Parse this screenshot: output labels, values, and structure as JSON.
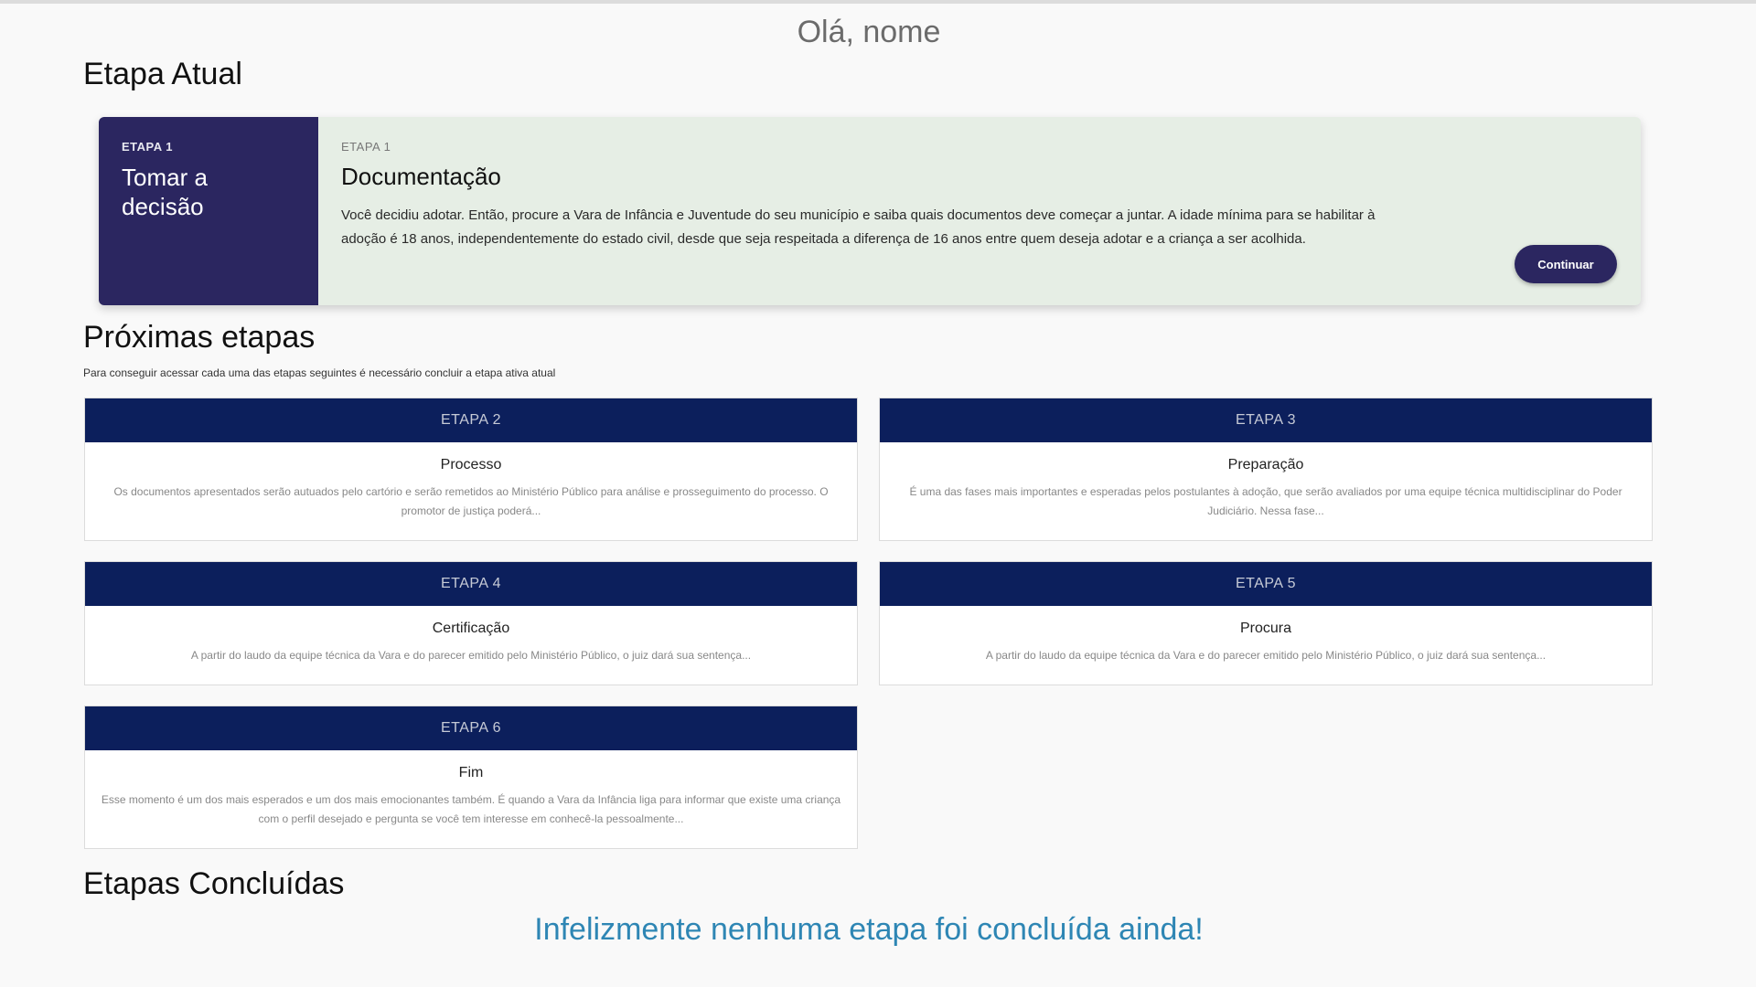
{
  "greeting": "Olá, nome",
  "sections": {
    "current_title": "Etapa Atual",
    "next_title": "Próximas etapas",
    "next_hint": "Para conseguir acessar cada uma das etapas seguintes é necessário concluir a etapa ativa atual",
    "done_title": "Etapas Concluídas",
    "done_empty": "Infelizmente nenhuma etapa foi concluída ainda!"
  },
  "current": {
    "left_eyebrow": "ETAPA 1",
    "left_name": "Tomar a decisão",
    "eyebrow": "ETAPA 1",
    "title": "Documentação",
    "description": "Você decidiu adotar. Então, procure a Vara de Infância e Juventude do seu município e saiba quais documentos deve começar a juntar. A idade mínima para se habilitar à adoção é 18 anos, independentemente do estado civil, desde que seja respeitada a diferença de 16 anos entre quem deseja adotar e a criança a ser acolhida.",
    "button": "Continuar"
  },
  "next_stages": [
    {
      "label": "ETAPA 2",
      "title": "Processo",
      "description": "Os documentos apresentados serão autuados pelo cartório e serão remetidos ao Ministério Público para análise e prosseguimento do processo. O promotor de justiça poderá..."
    },
    {
      "label": "ETAPA 3",
      "title": "Preparação",
      "description": "É uma das fases mais importantes e esperadas pelos postulantes à adoção, que serão avaliados por uma equipe técnica multidisciplinar do Poder Judiciário. Nessa fase..."
    },
    {
      "label": "ETAPA 4",
      "title": "Certificação",
      "description": "A partir do laudo da equipe técnica da Vara e do parecer emitido pelo Ministério Público, o juiz dará sua sentença..."
    },
    {
      "label": "ETAPA 5",
      "title": "Procura",
      "description": "A partir do laudo da equipe técnica da Vara e do parecer emitido pelo Ministério Público, o juiz dará sua sentença..."
    },
    {
      "label": "ETAPA 6",
      "title": "Fim",
      "description": "Esse momento é um dos mais esperados e um dos mais emocionantes também. É quando a Vara da Infância liga para informar que existe uma criança com o perfil desejado e pergunta se você tem interesse em conhecê-la pessoalmente..."
    }
  ]
}
